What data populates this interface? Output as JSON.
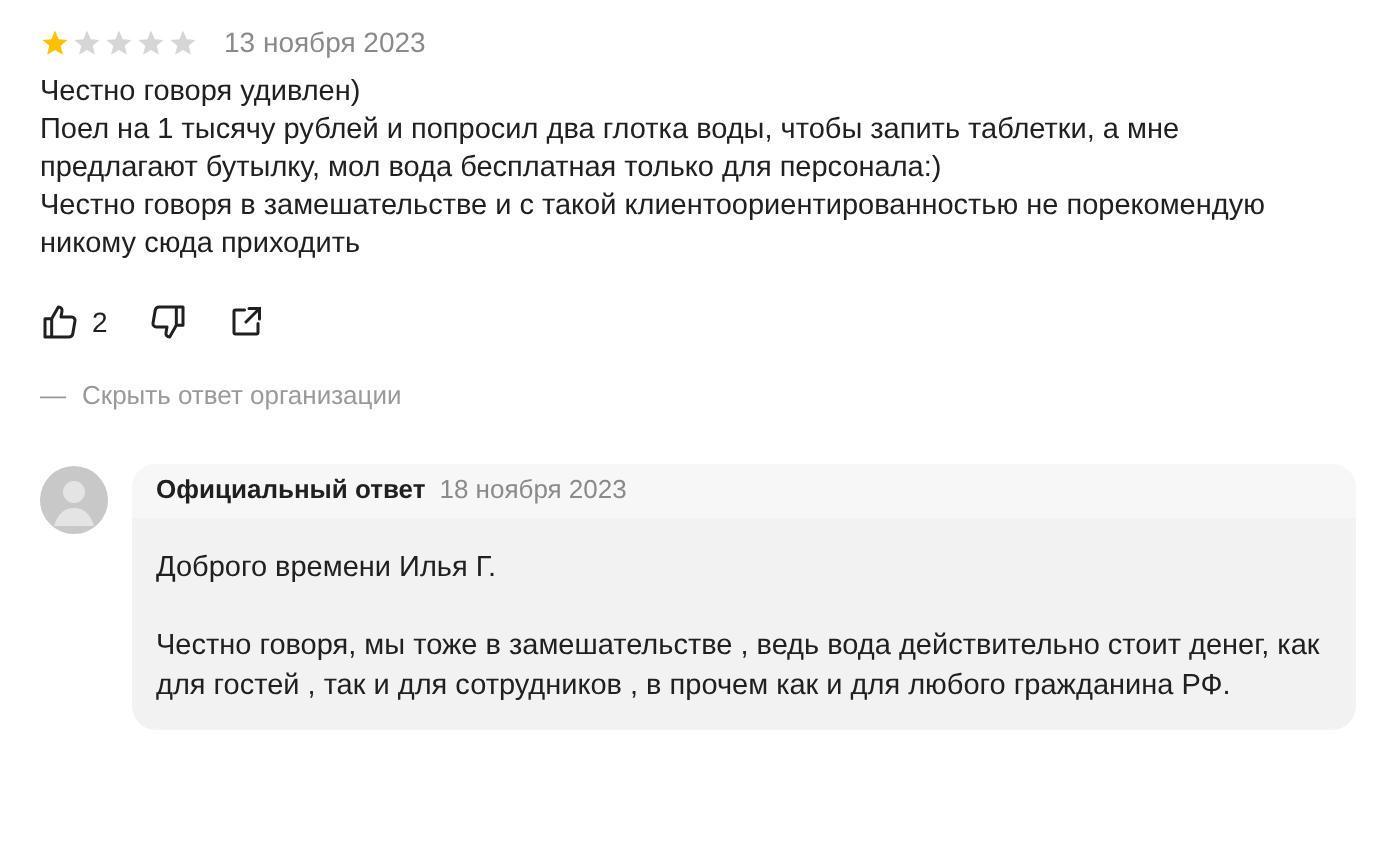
{
  "review": {
    "stars": 1,
    "date": "13 ноября 2023",
    "paragraphs": [
      "Честно говоря удивлен)",
      "Поел на 1 тысячу рублей и попросил два глотка воды, чтобы запить таблетки, а мне предлагают бутылку, мол вода бесплатная только для персонала:)",
      "Честно говоря в замешательстве и с такой клиентоориентированностью не порекомендую никому сюда приходить"
    ],
    "likes": "2"
  },
  "toggle": {
    "dash": "—",
    "label": "Скрыть ответ организации"
  },
  "reply": {
    "title": "Официальный ответ",
    "date": "18 ноября 2023",
    "paragraphs": [
      "Доброго времени Илья Г.",
      "Честно говоря, мы тоже в замешательстве , ведь вода действительно стоит денег, как для гостей , так и для сотрудников , в прочем как и для любого гражданина РФ."
    ]
  }
}
